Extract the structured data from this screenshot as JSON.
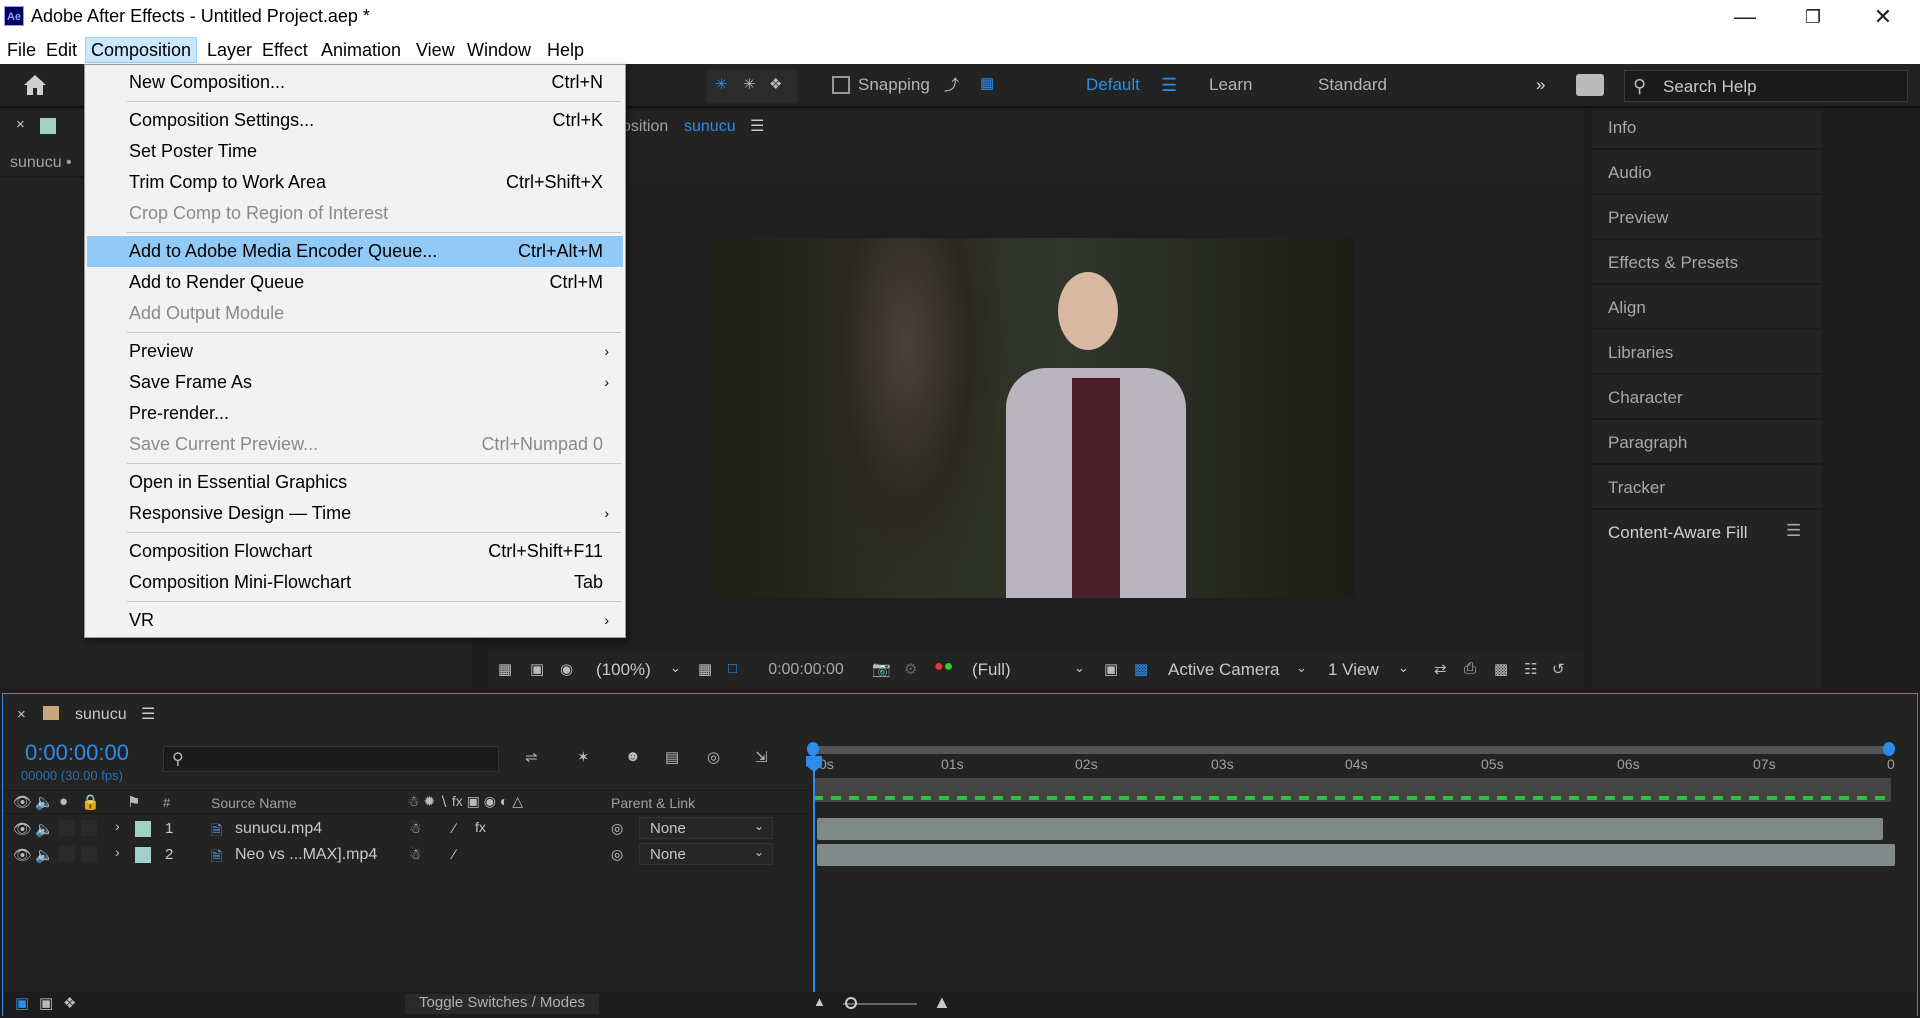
{
  "window": {
    "title": "Adobe After Effects - Untitled Project.aep *",
    "logo": "Ae"
  },
  "menubar": [
    "File",
    "Edit",
    "Composition",
    "Layer",
    "Effect",
    "Animation",
    "View",
    "Window",
    "Help"
  ],
  "toolbar": {
    "snapping": "Snapping",
    "workspaces": [
      "Default",
      "Learn",
      "Standard"
    ],
    "search_placeholder": "Search Help"
  },
  "project_panel": {
    "name_crop": "sunucu • "
  },
  "comp_panel": {
    "tab_prefix": "osition",
    "tab_name": "sunucu",
    "zoom": "(100%)",
    "timecode": "0:00:00:00",
    "resolution": "(Full)",
    "camera": "Active Camera",
    "views": "1 View"
  },
  "context_menu": [
    {
      "label": "New Composition...",
      "shortcut": "Ctrl+N"
    },
    {
      "label": "Composition Settings...",
      "shortcut": "Ctrl+K",
      "sep_before": true
    },
    {
      "label": "Set Poster Time",
      "shortcut": ""
    },
    {
      "label": "Trim Comp to Work Area",
      "shortcut": "Ctrl+Shift+X"
    },
    {
      "label": "Crop Comp to Region of Interest",
      "shortcut": "",
      "disabled": true
    },
    {
      "label": "Add to Adobe Media Encoder Queue...",
      "shortcut": "Ctrl+Alt+M",
      "sep_before": true,
      "highlight": true
    },
    {
      "label": "Add to Render Queue",
      "shortcut": "Ctrl+M"
    },
    {
      "label": "Add Output Module",
      "shortcut": "",
      "disabled": true
    },
    {
      "label": "Preview",
      "shortcut": "",
      "submenu": true,
      "sep_before": true
    },
    {
      "label": "Save Frame As",
      "shortcut": "",
      "submenu": true
    },
    {
      "label": "Pre-render...",
      "shortcut": ""
    },
    {
      "label": "Save Current Preview...",
      "shortcut": "Ctrl+Numpad 0",
      "disabled": true
    },
    {
      "label": "Open in Essential Graphics",
      "shortcut": "",
      "sep_before": true
    },
    {
      "label": "Responsive Design — Time",
      "shortcut": "",
      "submenu": true
    },
    {
      "label": "Composition Flowchart",
      "shortcut": "Ctrl+Shift+F11",
      "sep_before": true
    },
    {
      "label": "Composition Mini-Flowchart",
      "shortcut": "Tab"
    },
    {
      "label": "VR",
      "shortcut": "",
      "submenu": true,
      "sep_before": true
    }
  ],
  "right_panel": [
    "Info",
    "Audio",
    "Preview",
    "Effects & Presets",
    "Align",
    "Libraries",
    "Character",
    "Paragraph",
    "Tracker",
    "Content-Aware Fill"
  ],
  "timeline": {
    "tab": "sunucu",
    "timecode": "0:00:00:00",
    "frames": "00000 (30.00 fps)",
    "col_hash": "#",
    "col_source": "Source Name",
    "col_parent": "Parent & Link",
    "ruler": [
      "0s",
      "01s",
      "02s",
      "03s",
      "04s",
      "05s",
      "06s",
      "07s",
      "0"
    ],
    "layers": [
      {
        "num": "1",
        "name": "sunucu.mp4",
        "parent": "None"
      },
      {
        "num": "2",
        "name": "Neo vs ...MAX].mp4",
        "parent": "None"
      }
    ],
    "toggle": "Toggle Switches / Modes"
  },
  "colors": {
    "accent": "#2d8ceb",
    "menu_highlight": "#91c9f7",
    "label_teal": "#a3cfc9"
  }
}
